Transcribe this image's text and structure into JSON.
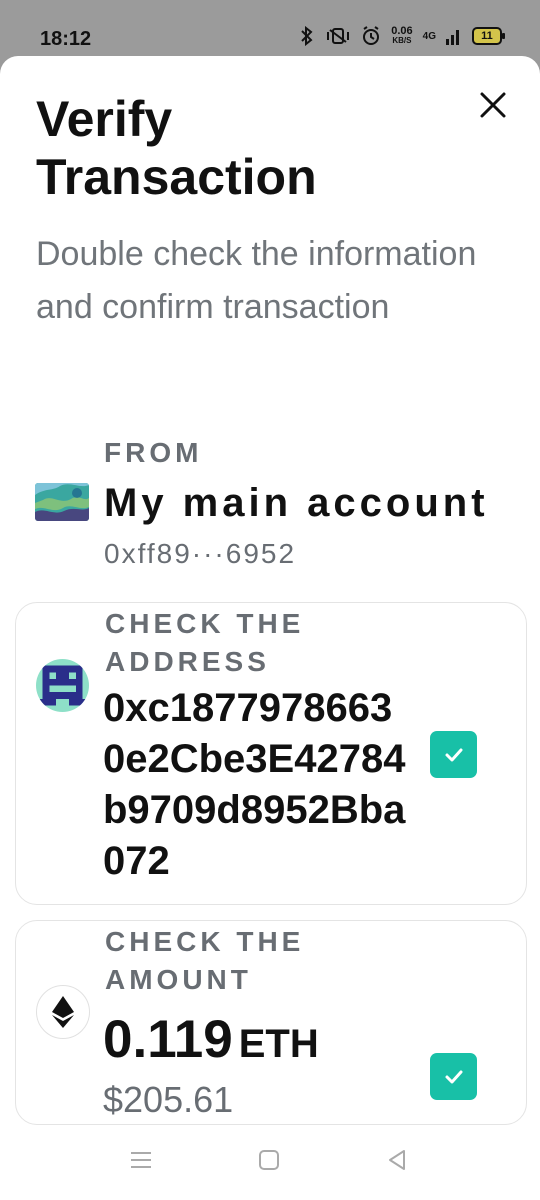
{
  "status_bar": {
    "time": "18:12",
    "speed_value": "0.06",
    "speed_unit": "KB/S",
    "network": "4G",
    "battery": "11"
  },
  "header": {
    "title": "Verify Transaction",
    "subtitle": "Double check the information and confirm transaction"
  },
  "from": {
    "label": "FROM",
    "account_name": "My main account",
    "address": "0xff89···6952"
  },
  "address_check": {
    "label": "CHECK THE ADDRESS",
    "address": "0xc18779786630e2Cbe3E42784b9709d8952Bba072",
    "checked": true
  },
  "amount_check": {
    "label": "CHECK THE AMOUNT",
    "value": "0.119",
    "unit": "ETH",
    "fiat": "$205.61",
    "checked": true
  },
  "icons": {
    "close": "close-icon",
    "check": "checkmark-icon",
    "eth": "ethereum-icon",
    "nav_menu": "menu-icon",
    "nav_home": "home-icon",
    "nav_back": "back-icon"
  },
  "colors": {
    "accent": "#18c0a7",
    "muted_text": "#686d73",
    "card_border": "#e4e4e4"
  }
}
